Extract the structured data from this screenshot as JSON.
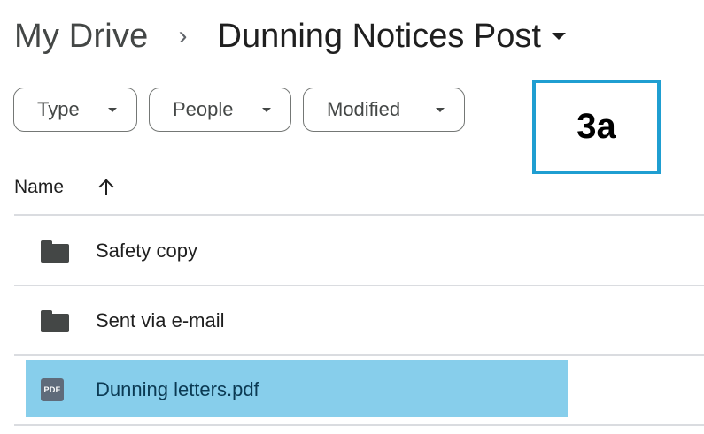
{
  "breadcrumb": {
    "root": "My Drive",
    "separator": "›",
    "current": "Dunning Notices Post"
  },
  "filters": {
    "type": "Type",
    "people": "People",
    "modified": "Modified"
  },
  "annotation": {
    "step_label": "3a",
    "border_color": "#1f9ed1"
  },
  "list": {
    "column_name": "Name",
    "sort_direction": "ascending",
    "items": [
      {
        "label": "Safety copy",
        "icon": "folder-icon"
      },
      {
        "label": "Sent via e-mail",
        "icon": "folder-icon"
      },
      {
        "label": "Dunning letters.pdf",
        "icon": "pdf-icon",
        "icon_text": "PDF",
        "selected": true
      }
    ]
  },
  "colors": {
    "selection_highlight": "#87ceeb",
    "divider": "#dadce0"
  }
}
